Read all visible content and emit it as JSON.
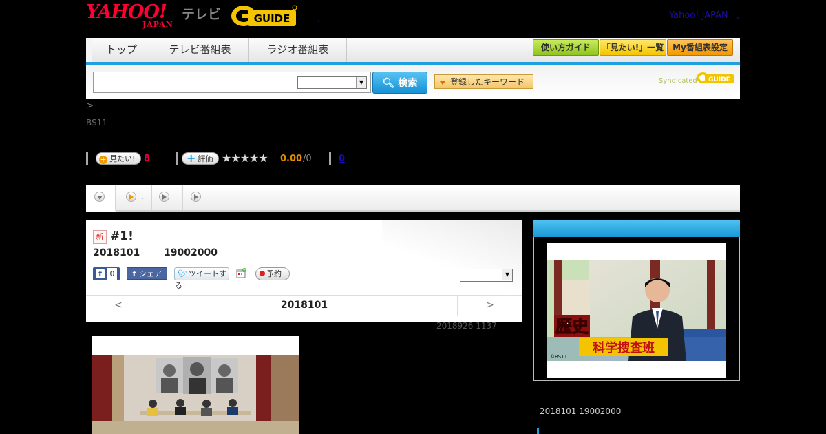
{
  "header": {
    "logo_yahoo": "YAHOO!",
    "logo_japan": "JAPAN",
    "logo_tv": "テレビ",
    "logo_gguide": "GUIDE",
    "yahoo_japan_link": "Yahoo! JAPAN",
    "link_sep": ","
  },
  "nav": {
    "tabs": [
      {
        "label": "トップ"
      },
      {
        "label": "テレビ番組表"
      },
      {
        "label": "ラジオ番組表"
      }
    ],
    "buttons": [
      {
        "label": "使い方ガイド"
      },
      {
        "label": "「見たい!」一覧"
      },
      {
        "label": "My番組表設定"
      }
    ]
  },
  "search": {
    "input_value": "",
    "select_value": "",
    "button_label": "検索",
    "keyword_button_label": "登録したキーワード",
    "syndicated_label": "Syndicated"
  },
  "breadcrumb": ">",
  "channel": "BS11",
  "ratings": {
    "want_label": "見たい!",
    "want_count": "8",
    "rate_label": "評価",
    "stars": "★★★★★",
    "score": "0.00",
    "score_count": "/0",
    "link_count": "0"
  },
  "subtabs": [
    {
      "label": ""
    },
    {
      "label": "."
    },
    {
      "label": ""
    },
    {
      "label": ""
    }
  ],
  "program": {
    "new_badge": "新",
    "title": "#1!",
    "date": "2018101",
    "time": "19002000",
    "fb_like_count": "0",
    "fb_share_label": "シェア",
    "tweet_label": "ツイートする",
    "reserve_label": "予約",
    "select_value": "",
    "pager_prev": "<",
    "pager_next": ">",
    "pager_date": "2018101",
    "updated": "2018926  1137"
  },
  "sidebar": {
    "image_title_top": "歴史",
    "image_title_bottom": "科学捜査班",
    "image_credit": "©BS11",
    "date_time": "2018101  19002000"
  }
}
